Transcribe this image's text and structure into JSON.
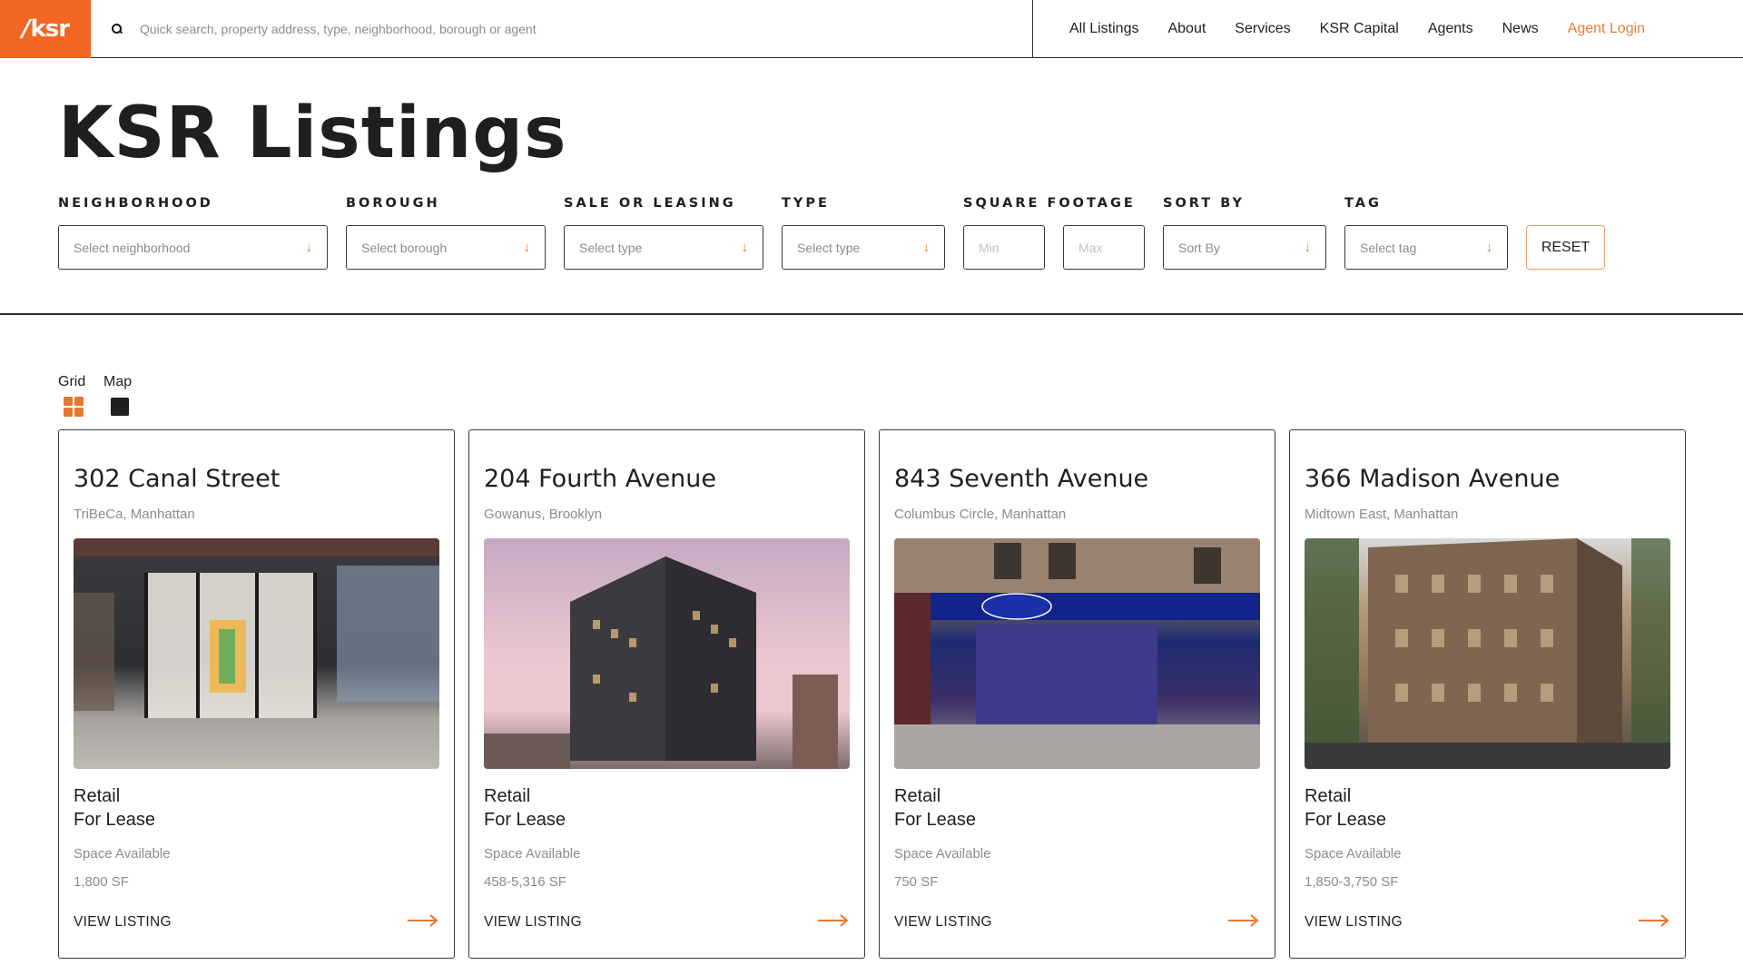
{
  "header": {
    "logo_text": "ksr",
    "search_placeholder": "Quick search, property address, type, neighborhood, borough or agent",
    "nav": [
      {
        "label": "All Listings"
      },
      {
        "label": "About"
      },
      {
        "label": "Services"
      },
      {
        "label": "KSR Capital"
      },
      {
        "label": "Agents"
      },
      {
        "label": "News"
      },
      {
        "label": "Agent Login",
        "color": "#e67e3a"
      }
    ]
  },
  "page_title": "KSR Listings",
  "filters": {
    "neighborhood": {
      "label": "NEIGHBORHOOD",
      "placeholder": "Select neighborhood"
    },
    "borough": {
      "label": "BOROUGH",
      "placeholder": "Select borough"
    },
    "sale_or_leasing": {
      "label": "SALE OR LEASING",
      "placeholder": "Select type"
    },
    "type": {
      "label": "TYPE",
      "placeholder": "Select type"
    },
    "square_footage": {
      "label": "SQUARE FOOTAGE",
      "min_placeholder": "Min",
      "max_placeholder": "Max"
    },
    "sort_by": {
      "label": "SORT BY",
      "placeholder": "Sort By"
    },
    "tag": {
      "label": "TAG",
      "placeholder": "Select tag"
    },
    "reset_label": "RESET",
    "arrow_icon": "arrow-down-icon"
  },
  "view_toggle": {
    "grid_label": "Grid",
    "map_label": "Map",
    "grid_icon": "grid-icon",
    "map_icon": "map-square-icon",
    "active": "grid"
  },
  "listings": [
    {
      "title": "302 Canal Street",
      "location": "TriBeCa, Manhattan",
      "type": "Retail",
      "deal": "For Lease",
      "space_label": "Space Available",
      "size": "1,800 SF",
      "cta": "VIEW LISTING"
    },
    {
      "title": "204 Fourth Avenue",
      "location": "Gowanus, Brooklyn",
      "type": "Retail",
      "deal": "For Lease",
      "space_label": "Space Available",
      "size": "458-5,316 SF",
      "cta": "VIEW LISTING"
    },
    {
      "title": "843 Seventh Avenue",
      "location": "Columbus Circle, Manhattan",
      "type": "Retail",
      "deal": "For Lease",
      "space_label": "Space Available",
      "size": "750 SF",
      "cta": "VIEW LISTING"
    },
    {
      "title": "366 Madison Avenue",
      "location": "Midtown East, Manhattan",
      "type": "Retail",
      "deal": "For Lease",
      "space_label": "Space Available",
      "size": "1,850-3,750 SF",
      "cta": "VIEW LISTING"
    }
  ],
  "colors": {
    "accent": "#f26522",
    "arrow": "#e6772e",
    "text": "#1f1f1f",
    "muted": "#8c8c8c"
  }
}
